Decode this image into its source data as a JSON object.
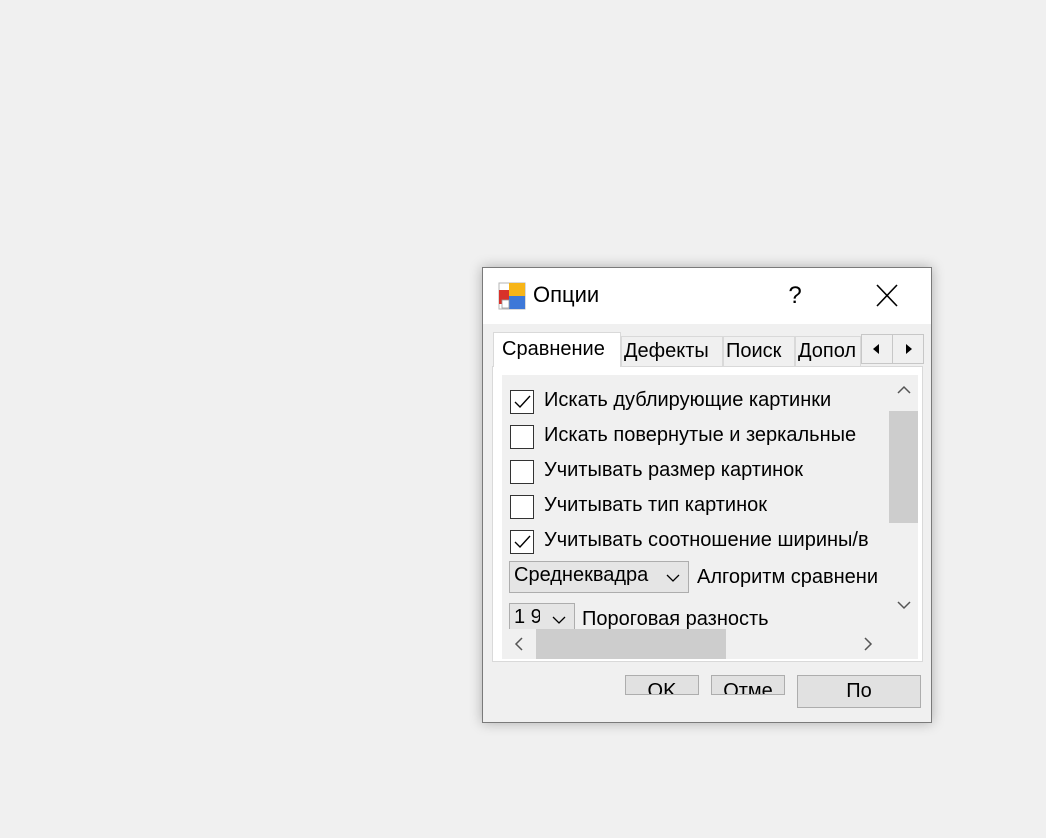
{
  "dialog": {
    "title": "Опции",
    "help_label": "?",
    "icons": {
      "app": "app-colored-squares-icon",
      "close": "close-icon"
    }
  },
  "tabs": [
    {
      "label": "Сравнение",
      "active": true
    },
    {
      "label": "Дефекты",
      "active": false
    },
    {
      "label": "Поиск",
      "active": false
    },
    {
      "label": "Допол",
      "active": false
    }
  ],
  "options": [
    {
      "label": "Искать дублирующие картинки",
      "checked": true
    },
    {
      "label": "Искать повернутые и зеркальные",
      "checked": false
    },
    {
      "label": "Учитывать размер картинок",
      "checked": false
    },
    {
      "label": "Учитывать тип картинок",
      "checked": false
    },
    {
      "label": "Учитывать соотношение ширины/в",
      "checked": true
    }
  ],
  "algorithm": {
    "value": "Среднеквадра",
    "label": "Алгоритм сравнени"
  },
  "threshold": {
    "value": "1 9",
    "label": "Пороговая разность"
  },
  "buttons": {
    "ok": "OK",
    "cancel": "Отме",
    "apply": "По"
  }
}
